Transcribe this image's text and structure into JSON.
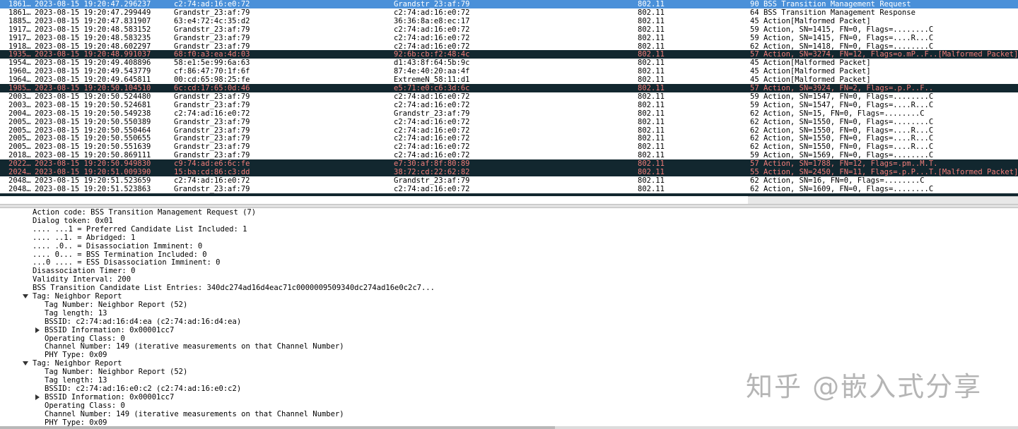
{
  "packet_list": {
    "rows": [
      {
        "no": "1861…",
        "time": "2023-08-15 19:20:47.296237",
        "src": "c2:74:ad:16:e0:72",
        "dst": "Grandstr_23:af:79",
        "proto": "802.11",
        "info": "90 BSS Transition Management Request",
        "state": "selected"
      },
      {
        "no": "1861…",
        "time": "2023-08-15 19:20:47.299449",
        "src": "Grandstr_23:af:79",
        "dst": "c2:74:ad:16:e0:72",
        "proto": "802.11",
        "info": "64 BSS Transition Management Response",
        "state": "normal"
      },
      {
        "no": "1885…",
        "time": "2023-08-15 19:20:47.831907",
        "src": "63:e4:72:4c:35:d2",
        "dst": "36:36:8a:e8:ec:17",
        "proto": "802.11",
        "info": "45 Action[Malformed Packet]",
        "state": "normal"
      },
      {
        "no": "1917…",
        "time": "2023-08-15 19:20:48.583152",
        "src": "Grandstr_23:af:79",
        "dst": "c2:74:ad:16:e0:72",
        "proto": "802.11",
        "info": "59 Action, SN=1415, FN=0, Flags=........C",
        "state": "normal"
      },
      {
        "no": "1917…",
        "time": "2023-08-15 19:20:48.583235",
        "src": "Grandstr_23:af:79",
        "dst": "c2:74:ad:16:e0:72",
        "proto": "802.11",
        "info": "59 Action, SN=1415, FN=0, Flags=....R...C",
        "state": "normal"
      },
      {
        "no": "1918…",
        "time": "2023-08-15 19:20:48.602297",
        "src": "Grandstr_23:af:79",
        "dst": "c2:74:ad:16:e0:72",
        "proto": "802.11",
        "info": "62 Action, SN=1418, FN=0, Flags=........C",
        "state": "normal"
      },
      {
        "no": "1935…",
        "time": "2023-08-15 19:20:48.991037",
        "src": "68:f0:a3:ea:4d:03",
        "dst": "92:6b:cb:f2:48:4c",
        "proto": "802.11",
        "info": "57 Action, SN=3274, FN=12, Flags=o.mP..F..[Malformed Packet]",
        "state": "dark"
      },
      {
        "no": "1954…",
        "time": "2023-08-15 19:20:49.408896",
        "src": "58:e1:5e:99:6a:63",
        "dst": "d1:43:8f:64:5b:9c",
        "proto": "802.11",
        "info": "45 Action[Malformed Packet]",
        "state": "normal"
      },
      {
        "no": "1960…",
        "time": "2023-08-15 19:20:49.543779",
        "src": "cf:86:47:70:1f:6f",
        "dst": "87:4e:40:20:aa:4f",
        "proto": "802.11",
        "info": "45 Action[Malformed Packet]",
        "state": "normal"
      },
      {
        "no": "1964…",
        "time": "2023-08-15 19:20:49.645811",
        "src": "00:cd:65:98:25:fe",
        "dst": "ExtremeN_58:11:d1",
        "proto": "802.11",
        "info": "45 Action[Malformed Packet]",
        "state": "normal"
      },
      {
        "no": "1985…",
        "time": "2023-08-15 19:20:50.104510",
        "src": "6c:cd:17:65:0d:46",
        "dst": "e5:71:e0:c6:3d:6c",
        "proto": "802.11",
        "info": "57 Action, SN=3924, FN=2, Flags=.p.P..F..",
        "state": "dark"
      },
      {
        "no": "2003…",
        "time": "2023-08-15 19:20:50.524480",
        "src": "Grandstr_23:af:79",
        "dst": "c2:74:ad:16:e0:72",
        "proto": "802.11",
        "info": "59 Action, SN=1547, FN=0, Flags=........C",
        "state": "normal"
      },
      {
        "no": "2003…",
        "time": "2023-08-15 19:20:50.524681",
        "src": "Grandstr_23:af:79",
        "dst": "c2:74:ad:16:e0:72",
        "proto": "802.11",
        "info": "59 Action, SN=1547, FN=0, Flags=....R...C",
        "state": "normal"
      },
      {
        "no": "2004…",
        "time": "2023-08-15 19:20:50.549238",
        "src": "c2:74:ad:16:e0:72",
        "dst": "Grandstr_23:af:79",
        "proto": "802.11",
        "info": "62 Action, SN=15, FN=0, Flags=........C",
        "state": "normal"
      },
      {
        "no": "2005…",
        "time": "2023-08-15 19:20:50.550389",
        "src": "Grandstr_23:af:79",
        "dst": "c2:74:ad:16:e0:72",
        "proto": "802.11",
        "info": "62 Action, SN=1550, FN=0, Flags=........C",
        "state": "normal"
      },
      {
        "no": "2005…",
        "time": "2023-08-15 19:20:50.550464",
        "src": "Grandstr_23:af:79",
        "dst": "c2:74:ad:16:e0:72",
        "proto": "802.11",
        "info": "62 Action, SN=1550, FN=0, Flags=....R...C",
        "state": "normal"
      },
      {
        "no": "2005…",
        "time": "2023-08-15 19:20:50.550655",
        "src": "Grandstr_23:af:79",
        "dst": "c2:74:ad:16:e0:72",
        "proto": "802.11",
        "info": "62 Action, SN=1550, FN=0, Flags=....R...C",
        "state": "normal"
      },
      {
        "no": "2005…",
        "time": "2023-08-15 19:20:50.551639",
        "src": "Grandstr_23:af:79",
        "dst": "c2:74:ad:16:e0:72",
        "proto": "802.11",
        "info": "62 Action, SN=1550, FN=0, Flags=....R...C",
        "state": "normal"
      },
      {
        "no": "2018…",
        "time": "2023-08-15 19:20:50.869111",
        "src": "Grandstr_23:af:79",
        "dst": "c2:74:ad:16:e0:72",
        "proto": "802.11",
        "info": "59 Action, SN=1569, FN=0, Flags=........C",
        "state": "normal"
      },
      {
        "no": "2022…",
        "time": "2023-08-15 19:20:50.949830",
        "src": "c9:74:ad:e6:6c:fe",
        "dst": "e7:30:af:8f:80:89",
        "proto": "802.11",
        "info": "57 Action, SN=1788, FN=12, Flags=.pm..M.T.",
        "state": "dark"
      },
      {
        "no": "2024…",
        "time": "2023-08-15 19:20:51.009390",
        "src": "15:ba:cd:86:c3:dd",
        "dst": "38:72:cd:22:62:82",
        "proto": "802.11",
        "info": "55 Action, SN=2450, FN=11, Flags=.p.P...T.[Malformed Packet]",
        "state": "dark"
      },
      {
        "no": "2048…",
        "time": "2023-08-15 19:20:51.523659",
        "src": "c2:74:ad:16:e0:72",
        "dst": "Grandstr_23:af:79",
        "proto": "802.11",
        "info": "62 Action, SN=16, FN=0, Flags=........C",
        "state": "normal"
      },
      {
        "no": "2048…",
        "time": "2023-08-15 19:20:51.523863",
        "src": "Grandstr_23:af:79",
        "dst": "c2:74:ad:16:e0:72",
        "proto": "802.11",
        "info": "62 Action, SN=1609, FN=0, Flags=........C",
        "state": "normal"
      },
      {
        "no": "",
        "time": "",
        "src": "",
        "dst": "",
        "proto": "",
        "info": "",
        "state": "dark partial"
      }
    ]
  },
  "details": {
    "lines": [
      {
        "indent": 0,
        "text": "Action code: BSS Transition Management Request (7)"
      },
      {
        "indent": 0,
        "text": "Dialog token: 0x01"
      },
      {
        "indent": 0,
        "text": ".... ...1 = Preferred Candidate List Included: 1"
      },
      {
        "indent": 0,
        "text": ".... ..1. = Abridged: 1"
      },
      {
        "indent": 0,
        "text": ".... .0.. = Disassociation Imminent: 0"
      },
      {
        "indent": 0,
        "text": ".... 0... = BSS Termination Included: 0"
      },
      {
        "indent": 0,
        "text": "...0 .... = ESS Disassociation Imminent: 0"
      },
      {
        "indent": 0,
        "text": "Disassociation Timer: 0"
      },
      {
        "indent": 0,
        "text": "Validity Interval: 200"
      },
      {
        "indent": 0,
        "text": "BSS Transition Candidate List Entries: 340dc274ad16d4eac71c0000009509340dc274ad16e0c2c7..."
      },
      {
        "indent": 0,
        "text": "Tag: Neighbor Report",
        "toggle": "down"
      },
      {
        "indent": 1,
        "text": "Tag Number: Neighbor Report (52)"
      },
      {
        "indent": 1,
        "text": "Tag length: 13"
      },
      {
        "indent": 1,
        "text": "BSSID: c2:74:ad:16:d4:ea (c2:74:ad:16:d4:ea)"
      },
      {
        "indent": 1,
        "text": "BSSID Information: 0x00001cc7",
        "toggle": "right"
      },
      {
        "indent": 1,
        "text": "Operating Class: 0"
      },
      {
        "indent": 1,
        "text": "Channel Number: 149 (iterative measurements on that Channel Number)"
      },
      {
        "indent": 1,
        "text": "PHY Type: 0x09"
      },
      {
        "indent": 0,
        "text": "Tag: Neighbor Report",
        "toggle": "down"
      },
      {
        "indent": 1,
        "text": "Tag Number: Neighbor Report (52)"
      },
      {
        "indent": 1,
        "text": "Tag length: 13"
      },
      {
        "indent": 1,
        "text": "BSSID: c2:74:ad:16:e0:c2 (c2:74:ad:16:e0:c2)"
      },
      {
        "indent": 1,
        "text": "BSSID Information: 0x00001cc7",
        "toggle": "right"
      },
      {
        "indent": 1,
        "text": "Operating Class: 0"
      },
      {
        "indent": 1,
        "text": "Channel Number: 149 (iterative measurements on that Channel Number)"
      },
      {
        "indent": 1,
        "text": "PHY Type: 0x09"
      }
    ]
  },
  "watermark": {
    "text": "知乎 @嵌入式分享"
  }
}
